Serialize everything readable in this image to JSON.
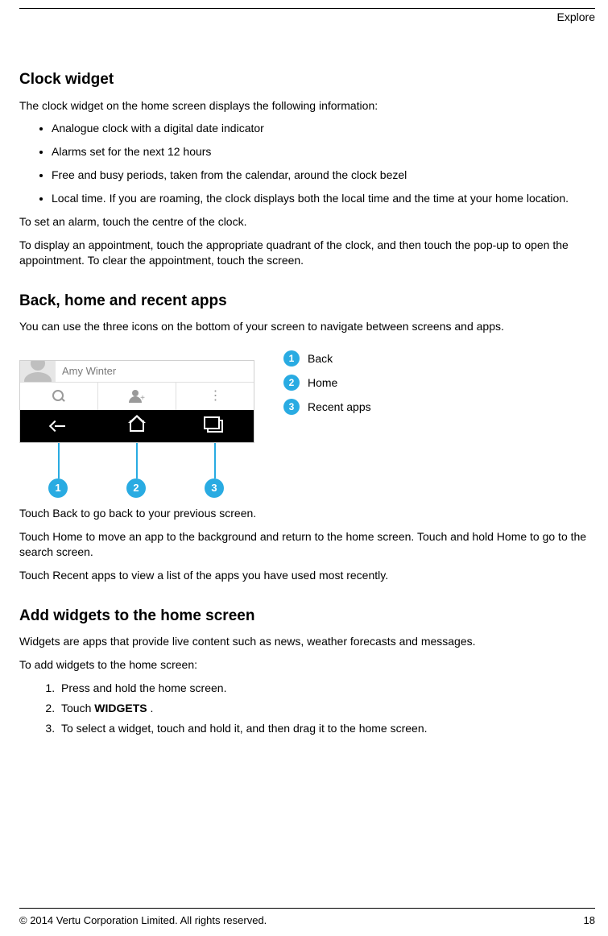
{
  "header": {
    "section_label": "Explore"
  },
  "clock_widget": {
    "heading": "Clock widget",
    "intro": "The clock widget on the home screen displays the following information:",
    "bullets": [
      "Analogue clock with a digital date indicator",
      "Alarms set for the next 12 hours",
      "Free and busy periods, taken from the calendar, around the clock bezel",
      "Local time. If you are roaming, the clock displays both the local time and the time at your home location."
    ],
    "para_alarm": "To set an alarm, touch the centre of the clock.",
    "para_appt": "To display an appointment, touch the appropriate quadrant of the clock, and then touch the pop-up to open the appointment. To clear the appointment, touch the screen."
  },
  "back_home": {
    "heading": "Back, home and recent apps",
    "intro": "You can use the three icons on the bottom of your screen to navigate between screens and apps.",
    "legend": [
      {
        "num": "1",
        "label": "Back"
      },
      {
        "num": "2",
        "label": "Home"
      },
      {
        "num": "3",
        "label": "Recent apps"
      }
    ],
    "mock_contact_name": "Amy Winter",
    "para_back": "Touch Back to go back to your previous screen.",
    "para_home": "Touch Home to move an app to the background and return to the home screen. Touch and hold Home to go to the search screen.",
    "para_recent": "Touch Recent apps to view a list of the apps you have used most recently."
  },
  "add_widgets": {
    "heading": "Add widgets to the home screen",
    "intro": "Widgets are apps that provide live content such as news, weather forecasts and messages.",
    "lead": "To add widgets to the home screen:",
    "steps": {
      "s1": "Press and hold the home screen.",
      "s2_prefix": "Touch ",
      "s2_bold": "  WIDGETS ",
      "s2_suffix": ".",
      "s3": "To select a widget, touch and hold it, and then drag it to the home screen."
    }
  },
  "footer": {
    "copyright": "© 2014 Vertu Corporation Limited. All rights reserved.",
    "page": "18"
  }
}
